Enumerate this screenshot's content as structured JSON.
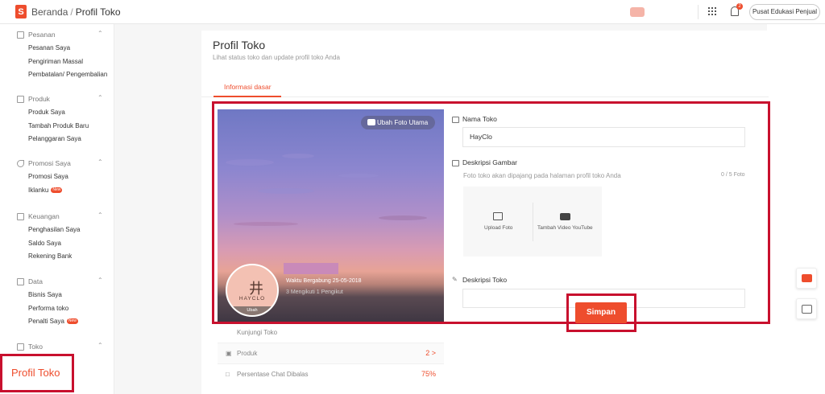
{
  "topbar": {
    "logo": "S",
    "breadcrumb_home": "Beranda",
    "breadcrumb_sep": "/",
    "breadcrumb_current": "Profil Toko",
    "notif_count": "2",
    "edu_button": "Pusat Edukasi Penjual"
  },
  "sidebar": {
    "groups": [
      {
        "label": "Pesanan",
        "items": [
          "Pesanan Saya",
          "Pengiriman Massal",
          "Pembatalan/ Pengembalian"
        ]
      },
      {
        "label": "Produk",
        "items": [
          "Produk Saya",
          "Tambah Produk Baru",
          "Pelanggaran Saya"
        ]
      },
      {
        "label": "Promosi Saya",
        "items": [
          "Promosi Saya",
          "Iklanku"
        ]
      },
      {
        "label": "Keuangan",
        "items": [
          "Penghasilan Saya",
          "Saldo Saya",
          "Rekening Bank"
        ]
      },
      {
        "label": "Data",
        "items": [
          "Bisnis Saya",
          "Performa toko",
          "Penalti Saya"
        ]
      },
      {
        "label": "Toko",
        "items": []
      }
    ],
    "new_badge": "New",
    "highlighted_item": "Profil Toko"
  },
  "page": {
    "title": "Profil Toko",
    "subtitle": "Lihat status toko dan update profil toko Anda",
    "tab": "Informasi dasar"
  },
  "hero": {
    "change_photo": "Ubah Foto Utama",
    "logo_text": "HAYCLO",
    "avatar_change": "Ubah",
    "joined": "Waktu Bergabung 25-05-2018",
    "follow_stats": "3  Mengikuti  1  Pengikut"
  },
  "stats": [
    {
      "label": "Kunjungi Toko",
      "value": ""
    },
    {
      "label": "Produk",
      "value": "2 >"
    },
    {
      "label": "Persentase Chat Dibalas",
      "value": "75%"
    }
  ],
  "form": {
    "nama_label": "Nama Toko",
    "nama_value": "HayClo",
    "desc_image_label": "Deskripsi Gambar",
    "desc_image_hint": "Foto toko akan dipajang pada halaman profil toko Anda",
    "foto_count": "0 / 5 Foto",
    "upload_photo": "Upload Foto",
    "add_video": "Tambah Video YouTube",
    "desc_label": "Deskripsi Toko",
    "save": "Simpan"
  },
  "colors": {
    "accent": "#ee4d2d",
    "highlight": "#c8102e"
  }
}
